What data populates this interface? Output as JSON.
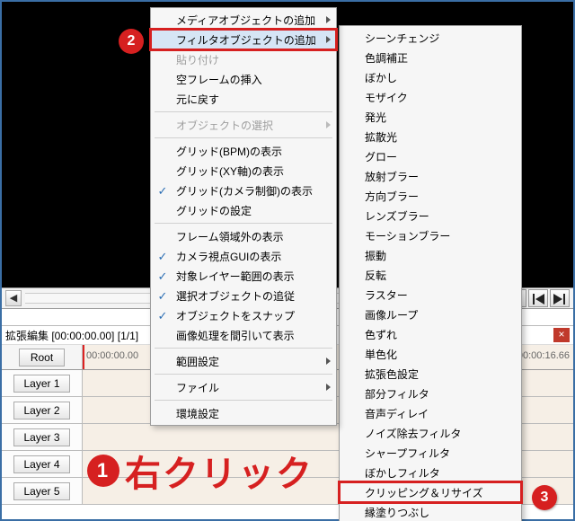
{
  "preview": {},
  "transport": {},
  "editor": {
    "title": "拡張編集 [00:00:00.00] [1/1]"
  },
  "timeline": {
    "root_label": "Root",
    "time_start": "00:00:00.00",
    "time_end": "00:00:16.66",
    "layers": [
      "Layer 1",
      "Layer 2",
      "Layer 3",
      "Layer 4",
      "Layer 5"
    ]
  },
  "menu_main": [
    {
      "label": "メディアオブジェクトの追加",
      "submenu": true
    },
    {
      "label": "フィルタオブジェクトの追加",
      "submenu": true,
      "hover": true,
      "marker": 2
    },
    {
      "label": "貼り付け",
      "disabled": true
    },
    {
      "label": "空フレームの挿入"
    },
    {
      "label": "元に戻す"
    },
    {
      "sep": true
    },
    {
      "label": "オブジェクトの選択",
      "submenu": true,
      "disabled": true
    },
    {
      "sep": true
    },
    {
      "label": "グリッド(BPM)の表示"
    },
    {
      "label": "グリッド(XY軸)の表示"
    },
    {
      "label": "グリッド(カメラ制御)の表示",
      "checked": true
    },
    {
      "label": "グリッドの設定"
    },
    {
      "sep": true
    },
    {
      "label": "フレーム領域外の表示"
    },
    {
      "label": "カメラ視点GUIの表示",
      "checked": true
    },
    {
      "label": "対象レイヤー範囲の表示",
      "checked": true
    },
    {
      "label": "選択オブジェクトの追従",
      "checked": true
    },
    {
      "label": "オブジェクトをスナップ",
      "checked": true
    },
    {
      "label": "画像処理を間引いて表示"
    },
    {
      "sep": true
    },
    {
      "label": "範囲設定",
      "submenu": true
    },
    {
      "sep": true
    },
    {
      "label": "ファイル",
      "submenu": true
    },
    {
      "sep": true
    },
    {
      "label": "環境設定"
    }
  ],
  "menu_sub": [
    "シーンチェンジ",
    "色調補正",
    "ぼかし",
    "モザイク",
    "発光",
    "拡散光",
    "グロー",
    "放射ブラー",
    "方向ブラー",
    "レンズブラー",
    "モーションブラー",
    "振動",
    "反転",
    "ラスター",
    "画像ループ",
    "色ずれ",
    "単色化",
    "拡張色設定",
    "部分フィルタ",
    "音声ディレイ",
    "ノイズ除去フィルタ",
    "シャープフィルタ",
    "ぼかしフィルタ",
    "クリッピング＆リサイズ",
    "縁塗りつぶし"
  ],
  "highlight_sub_index": 23,
  "annotations": {
    "big_text": "右クリック",
    "badge1": "1",
    "badge2": "2",
    "badge3": "3"
  }
}
